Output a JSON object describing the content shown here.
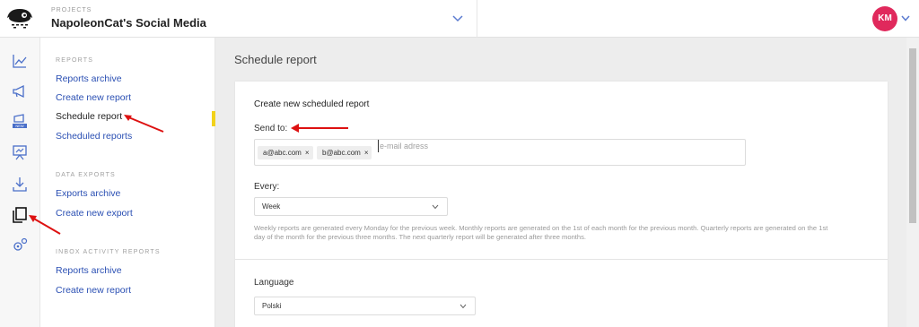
{
  "header": {
    "projects_label": "PROJECTS",
    "project_name": "NapoleonCat's Social Media",
    "user_initials": "KM",
    "avatar_color": "#e0295c"
  },
  "rail": {
    "icons": [
      "analytics-icon",
      "megaphone-icon",
      "new-publisher-icon",
      "presentation-icon",
      "download-icon",
      "reports-icon",
      "settings-icon"
    ]
  },
  "menu": {
    "reports_title": "REPORTS",
    "reports_items": [
      "Reports archive",
      "Create new report",
      "Schedule report",
      "Scheduled reports"
    ],
    "data_exports_title": "DATA EXPORTS",
    "data_exports_items": [
      "Exports archive",
      "Create new export"
    ],
    "inbox_title": "INBOX ACTIVITY REPORTS",
    "inbox_items": [
      "Reports archive",
      "Create new report"
    ],
    "active_color": "#f2d21b",
    "link_color": "#2a4fb3"
  },
  "main": {
    "page_title": "Schedule report",
    "card_title": "Create new scheduled report",
    "send_to_label": "Send to:",
    "email_tags": [
      "a@abc.com",
      "b@abc.com"
    ],
    "email_placeholder": "e-mail adress",
    "every_label": "Every:",
    "every_value": "Week",
    "help_text": "Weekly reports are generated every Monday for the previous week. Monthly reports are generated on the 1st of each month for the previous month. Quarterly reports are generated on the 1st day of the month for the previous three months. The next quarterly report will be generated after three months.",
    "language_label": "Language",
    "language_value": "Polski"
  }
}
